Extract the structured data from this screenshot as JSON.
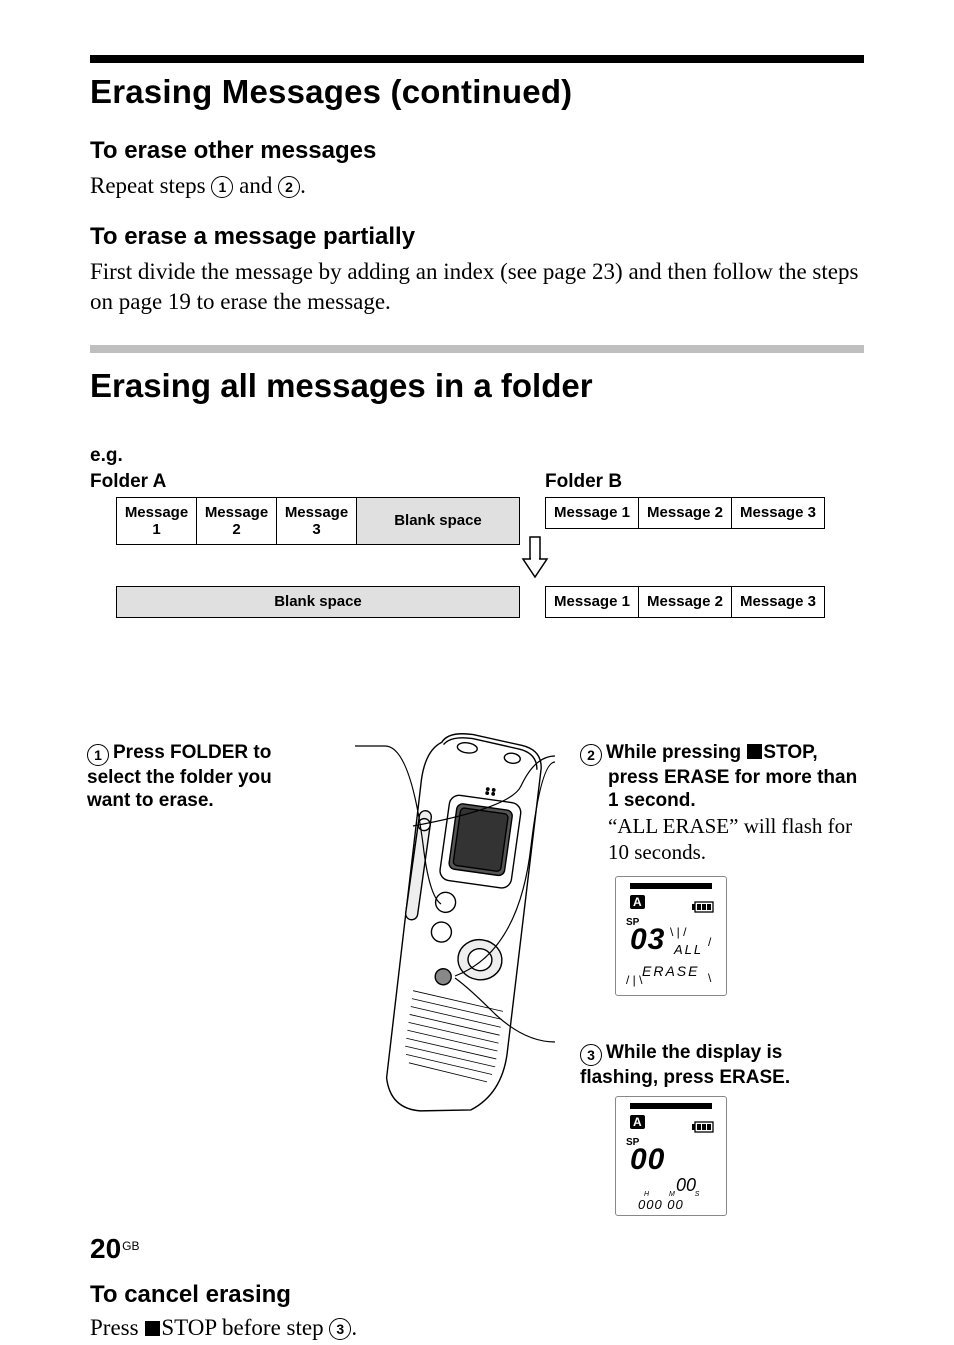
{
  "header": {
    "section_title": "Erasing Messages (continued)"
  },
  "sub1": {
    "heading": "To erase other messages",
    "body_prefix": "Repeat steps ",
    "step1": "1",
    "body_mid": " and ",
    "step2": "2",
    "body_suffix": "."
  },
  "sub2": {
    "heading": "To erase a message partially",
    "body": "First divide the message by adding an index (see page 23) and then follow the steps on page 19 to erase the message."
  },
  "major_heading": "Erasing all messages in a folder",
  "diagram": {
    "eg_label": "e.g.",
    "folder_a_label": "Folder A",
    "folder_b_label": "Folder B",
    "a_row1": [
      "Message 1",
      "Message 2",
      "Message 3",
      "Blank space"
    ],
    "a_row2": "Blank space",
    "b_row1": [
      "Message 1",
      "Message 2",
      "Message 3"
    ],
    "b_row2": [
      "Message 1",
      "Message 2",
      "Message 3"
    ]
  },
  "steps": {
    "s1_num": "1",
    "s1_text": "Press FOLDER to select the folder you want to erase.",
    "s2_num": "2",
    "s2_bold_pre": "While pressing ",
    "s2_bold_stop": "STOP,",
    "s2_bold_rest": "press ERASE for more than 1 second.",
    "s2_body": "“ALL ERASE” will flash for 10 seconds.",
    "s3_num": "3",
    "s3_text": "While the display is flashing, press ERASE."
  },
  "lcd1": {
    "folder": "A",
    "sp": "SP",
    "big": "03",
    "all": "ALL",
    "erase": "ERASE"
  },
  "lcd2": {
    "folder": "A",
    "sp": "SP",
    "big": "00",
    "sub": "00",
    "hms_labels": "H M S",
    "hms": "000 00"
  },
  "cancel": {
    "heading": "To cancel erasing",
    "body_pre": "Press ",
    "body_stop": "STOP before step ",
    "step": "3",
    "body_suffix": "."
  },
  "page": {
    "number": "20",
    "region": "GB"
  },
  "icons": {
    "stop_square": "stop-square",
    "arrow_down": "arrow-down-icon",
    "battery": "battery-icon",
    "folder_tag": "folder-tag-icon"
  }
}
